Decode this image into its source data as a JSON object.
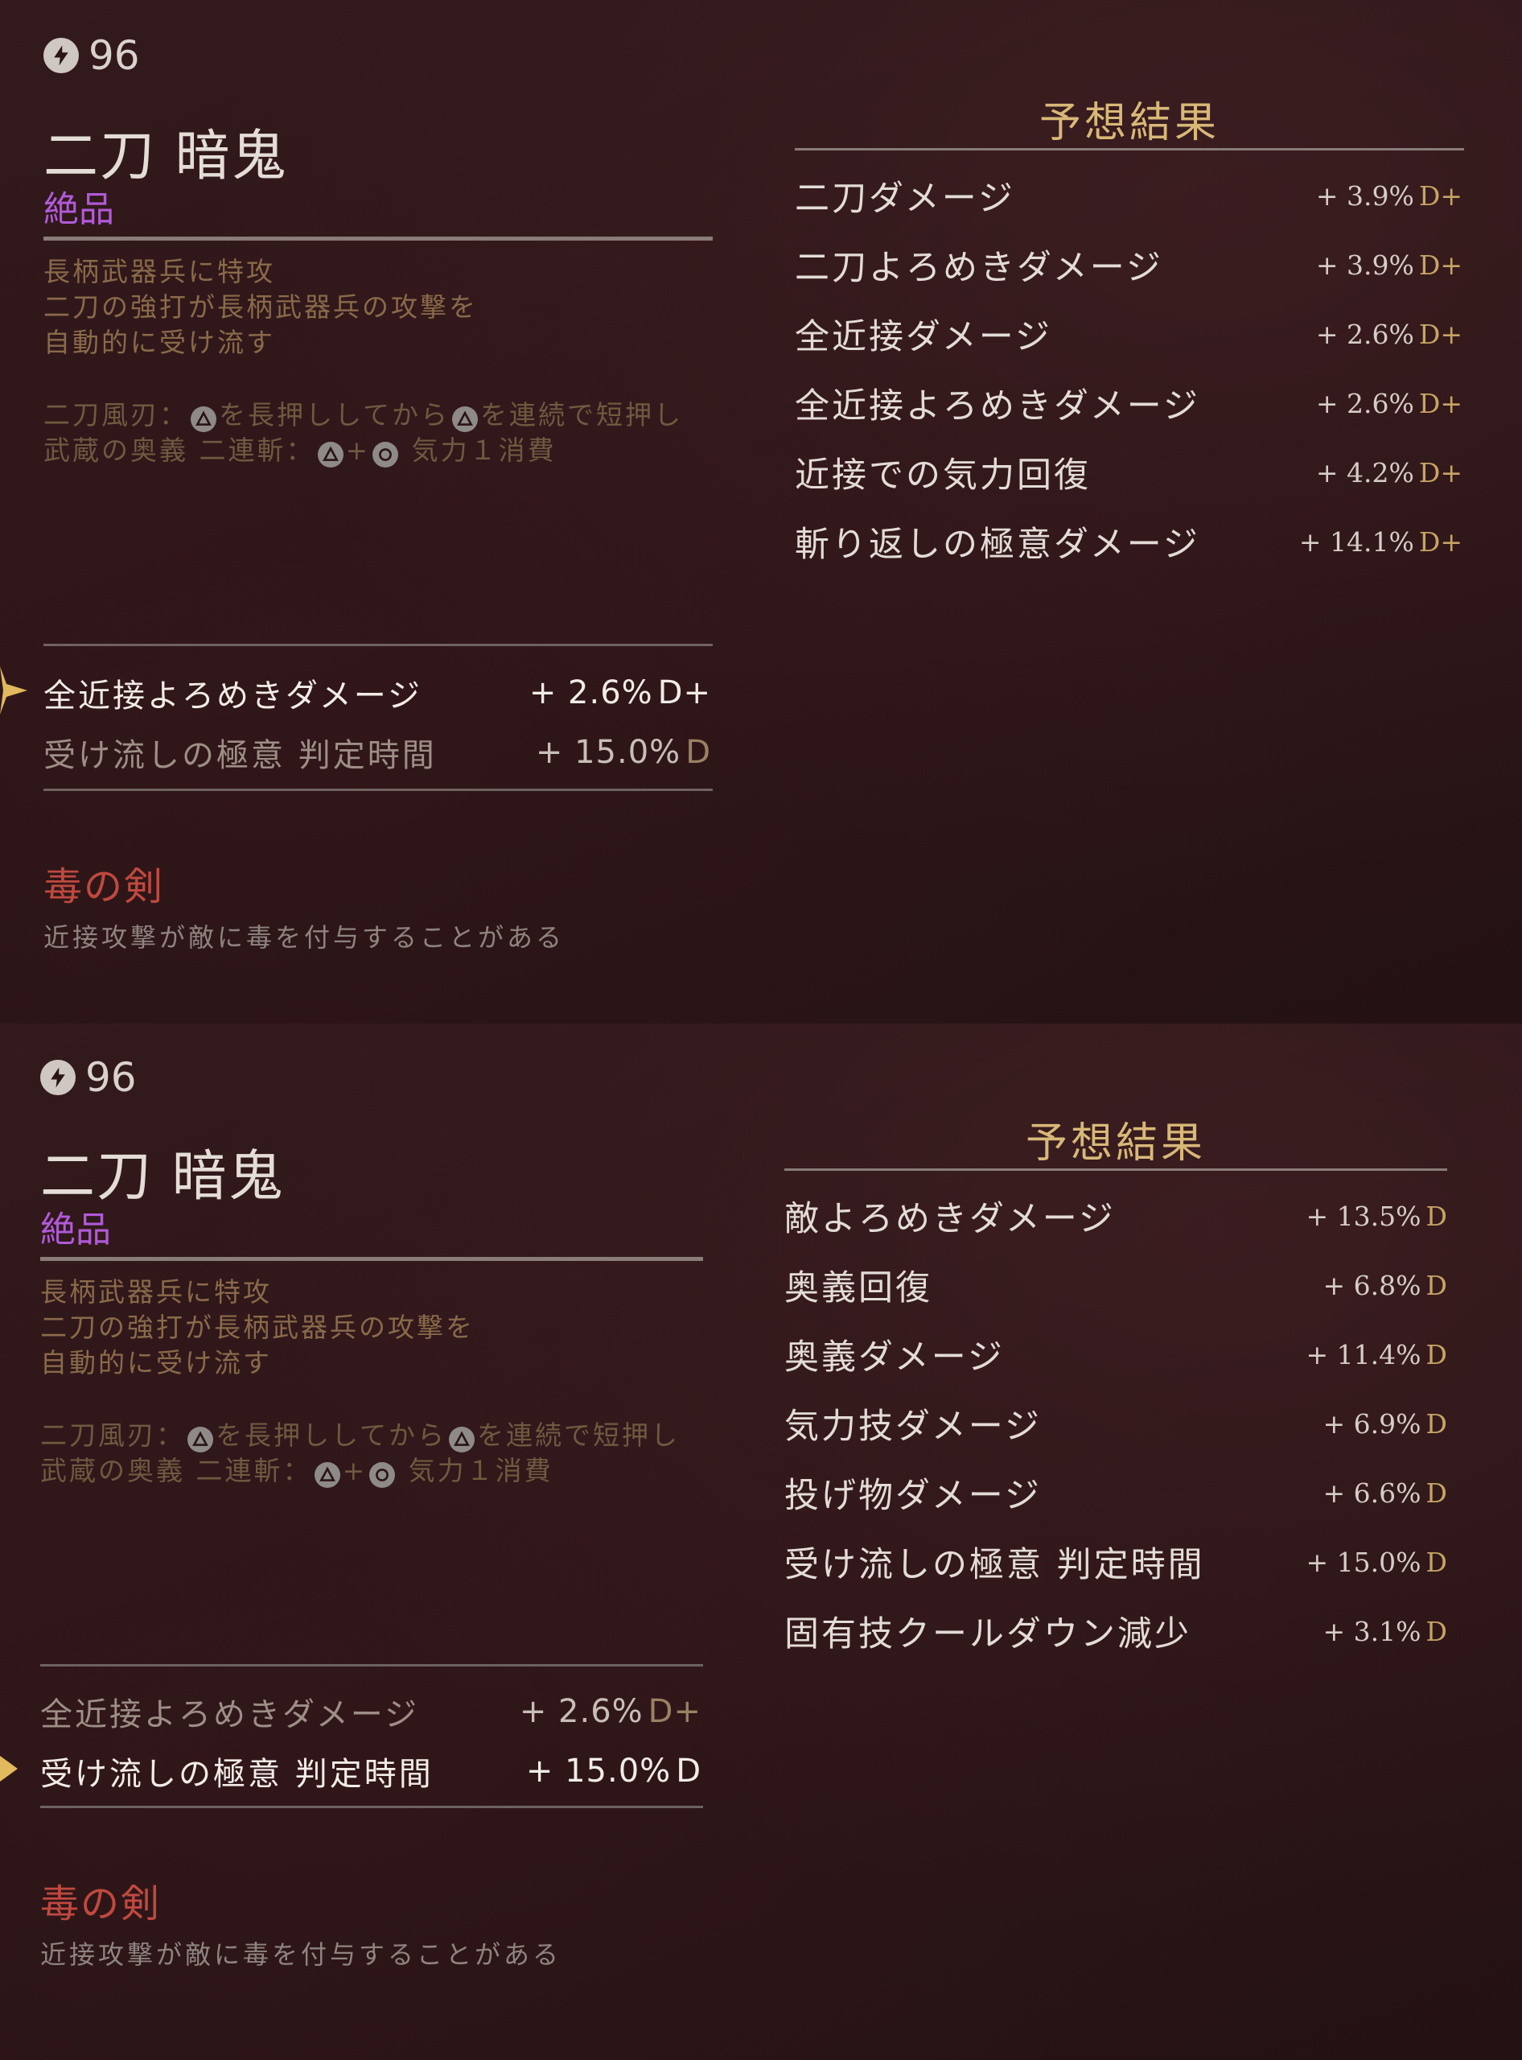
{
  "panels": [
    {
      "level": "96",
      "weapon_name": "二刀 暗鬼",
      "rarity": "絶品",
      "description": [
        "長柄武器兵に特攻",
        "二刀の強打が長柄武器兵の攻撃を",
        "自動的に受け流す"
      ],
      "skill_1": {
        "prefix": "二刀風刃：",
        "mid": "を長押ししてから",
        "suffix": "を連続で短押し"
      },
      "skill_2": {
        "prefix": "武蔵の奥義 二連斬：",
        "plus": "+",
        "suffix": " 気力１消費"
      },
      "stats": [
        {
          "label": "全近接よろめきダメージ",
          "value": "+ 2.6%",
          "grade": "D+",
          "active": true
        },
        {
          "label": "受け流しの極意 判定時間",
          "value": "+ 15.0%",
          "grade": "D",
          "active": false
        }
      ],
      "effect_title": "毒の剣",
      "effect_desc": "近接攻撃が敵に毒を付与することがある",
      "result_title": "予想結果",
      "results": [
        {
          "label": "二刀ダメージ",
          "value": "+ 3.9%",
          "grade": "D+"
        },
        {
          "label": "二刀よろめきダメージ",
          "value": "+ 3.9%",
          "grade": "D+"
        },
        {
          "label": "全近接ダメージ",
          "value": "+ 2.6%",
          "grade": "D+"
        },
        {
          "label": "全近接よろめきダメージ",
          "value": "+ 2.6%",
          "grade": "D+"
        },
        {
          "label": "近接での気力回復",
          "value": "+ 4.2%",
          "grade": "D+"
        },
        {
          "label": "斬り返しの極意ダメージ",
          "value": "+ 14.1%",
          "grade": "D+"
        }
      ]
    },
    {
      "level": "96",
      "weapon_name": "二刀 暗鬼",
      "rarity": "絶品",
      "description": [
        "長柄武器兵に特攻",
        "二刀の強打が長柄武器兵の攻撃を",
        "自動的に受け流す"
      ],
      "skill_1": {
        "prefix": "二刀風刃：",
        "mid": "を長押ししてから",
        "suffix": "を連続で短押し"
      },
      "skill_2": {
        "prefix": "武蔵の奥義 二連斬：",
        "plus": "+",
        "suffix": " 気力１消費"
      },
      "stats": [
        {
          "label": "全近接よろめきダメージ",
          "value": "+ 2.6%",
          "grade": "D+",
          "active": false
        },
        {
          "label": "受け流しの極意 判定時間",
          "value": "+ 15.0%",
          "grade": "D",
          "active": true
        }
      ],
      "effect_title": "毒の剣",
      "effect_desc": "近接攻撃が敵に毒を付与することがある",
      "result_title": "予想結果",
      "results": [
        {
          "label": "敵よろめきダメージ",
          "value": "+ 13.5%",
          "grade": "D"
        },
        {
          "label": "奥義回復",
          "value": "+ 6.8%",
          "grade": "D"
        },
        {
          "label": "奥義ダメージ",
          "value": "+ 11.4%",
          "grade": "D"
        },
        {
          "label": "気力技ダメージ",
          "value": "+ 6.9%",
          "grade": "D"
        },
        {
          "label": "投げ物ダメージ",
          "value": "+ 6.6%",
          "grade": "D"
        },
        {
          "label": "受け流しの極意 判定時間",
          "value": "+ 15.0%",
          "grade": "D"
        },
        {
          "label": "固有技クールダウン減少",
          "value": "+ 3.1%",
          "grade": "D"
        }
      ]
    }
  ],
  "colors": {
    "background": "#2a1416",
    "rarity": "#b05ad8",
    "grade": "#c7a464",
    "effect_title": "#c0493f",
    "result_title": "#d8b878"
  }
}
